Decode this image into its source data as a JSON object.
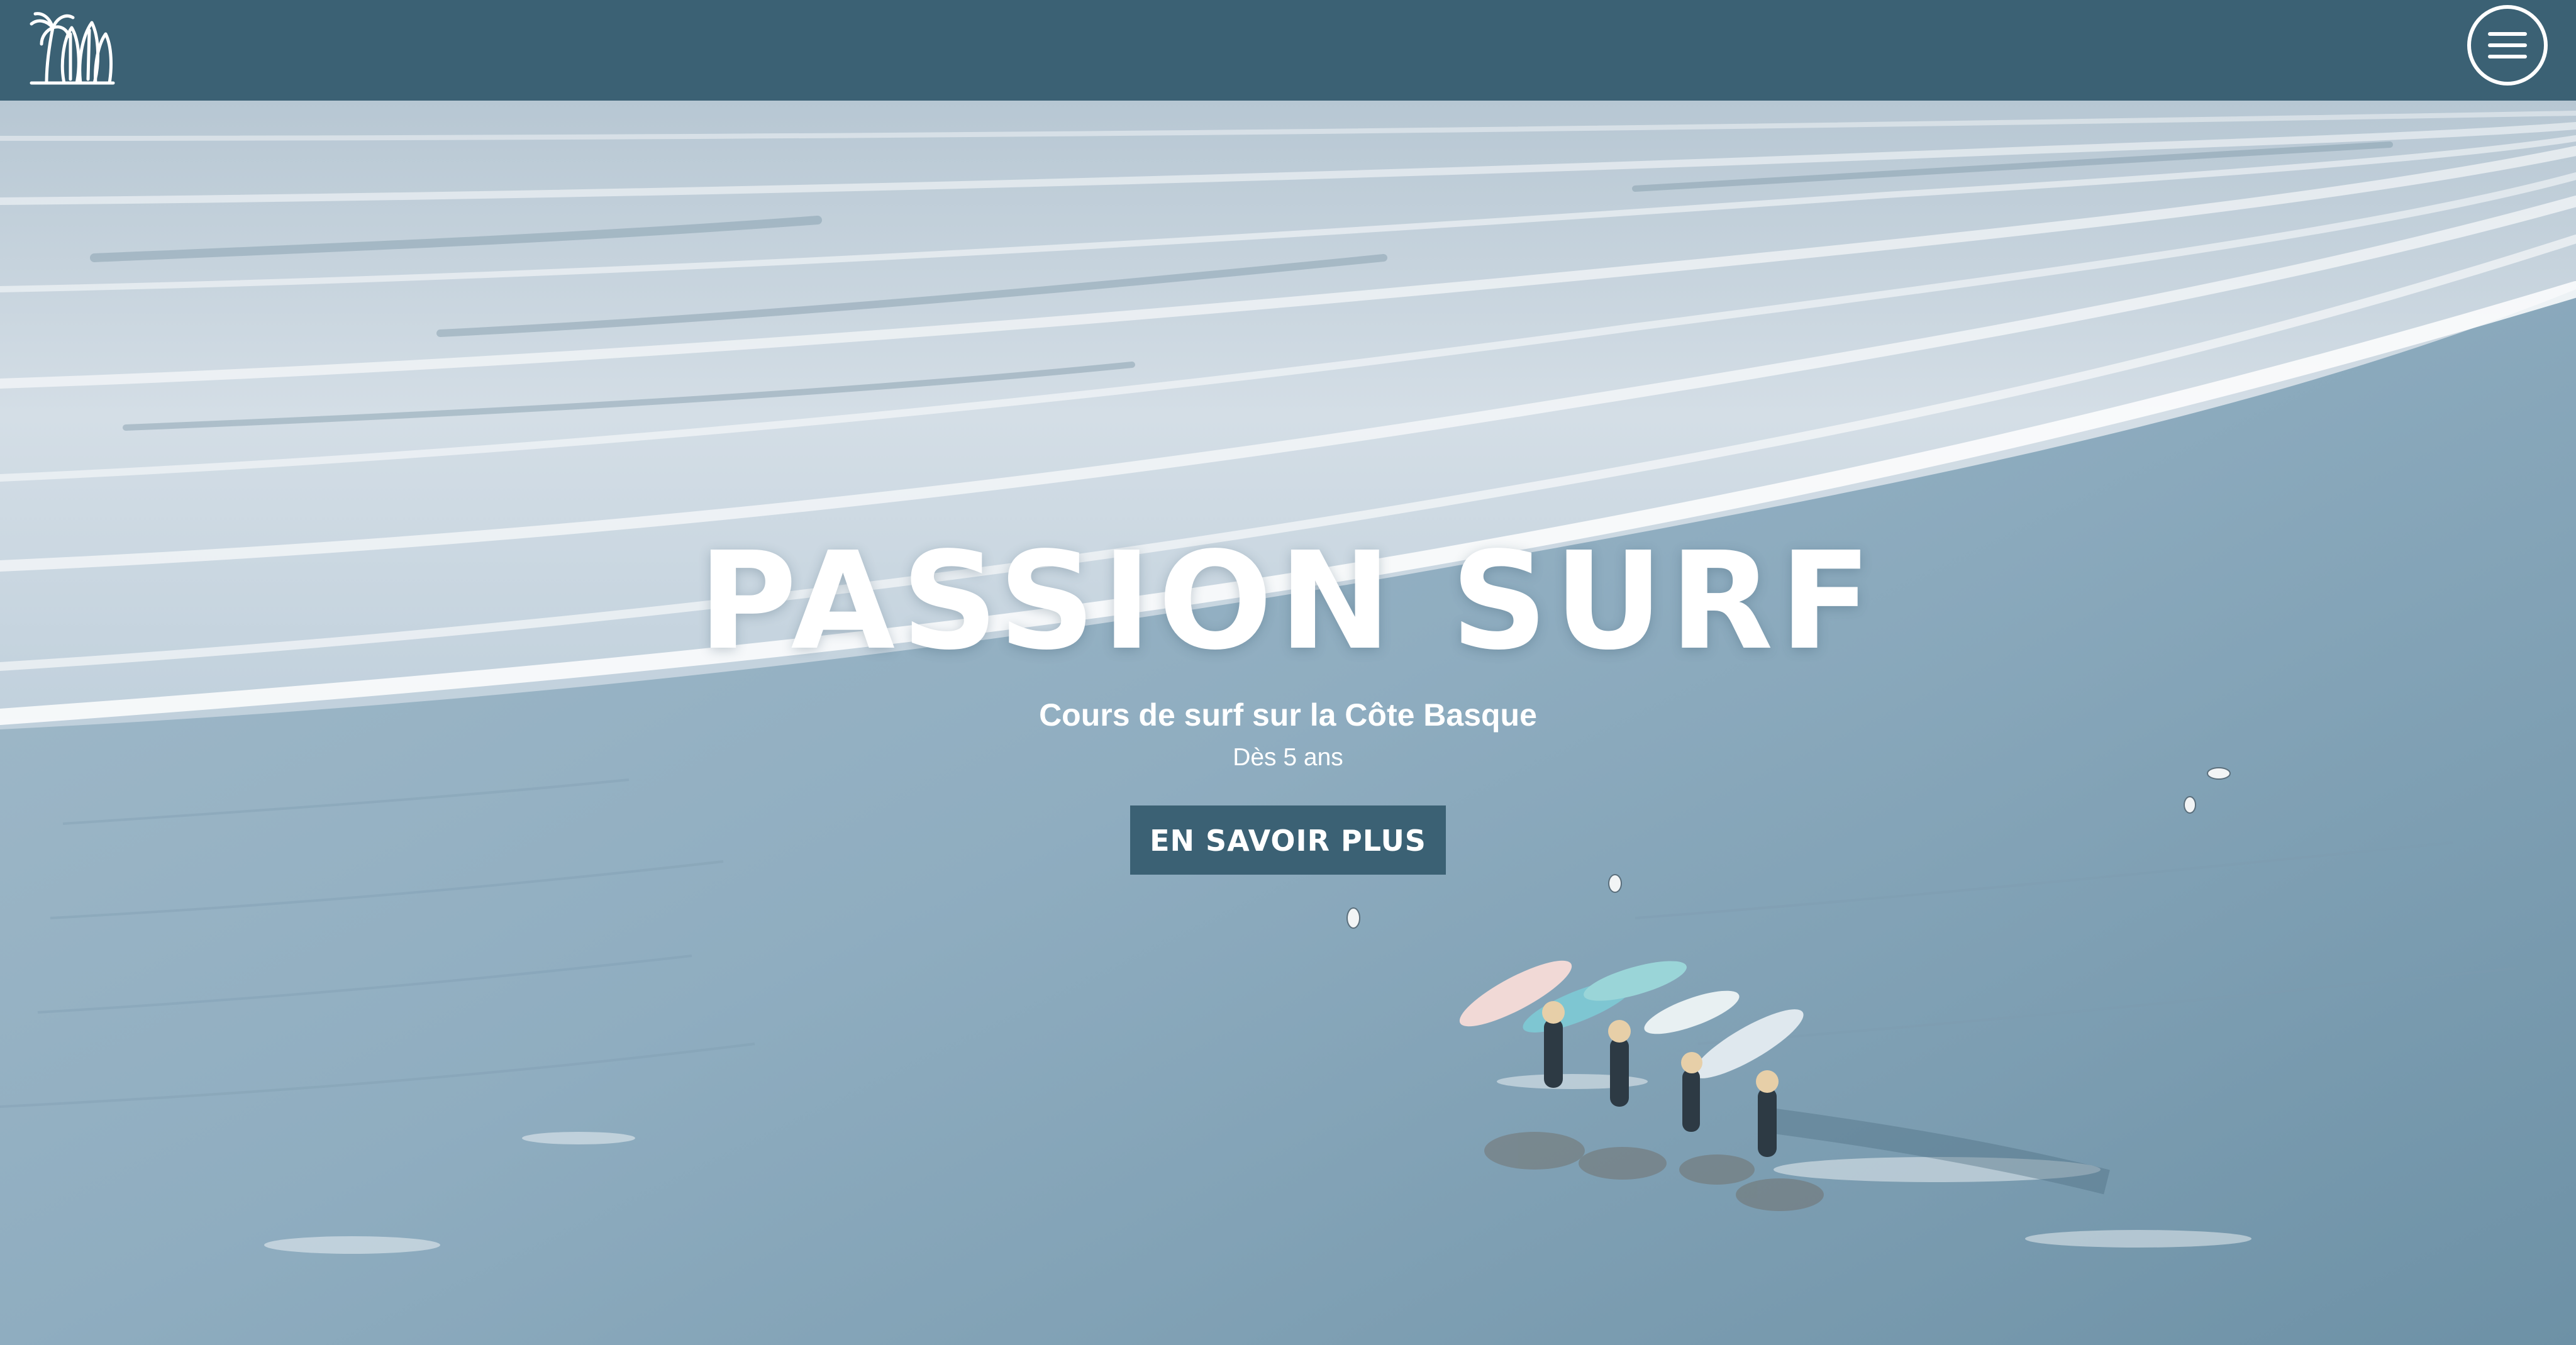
{
  "header": {
    "logo_icon": "palm-trees-surfboards-icon",
    "menu_icon": "hamburger-menu-icon",
    "background_color": "#3b6174"
  },
  "hero": {
    "title": "PASSION SURF",
    "subtitle": "Cours de surf sur la Côte Basque",
    "tagline": "Dès 5 ans",
    "cta_label": "EN SAVOIR PLUS",
    "cta_color": "#3b6174"
  }
}
